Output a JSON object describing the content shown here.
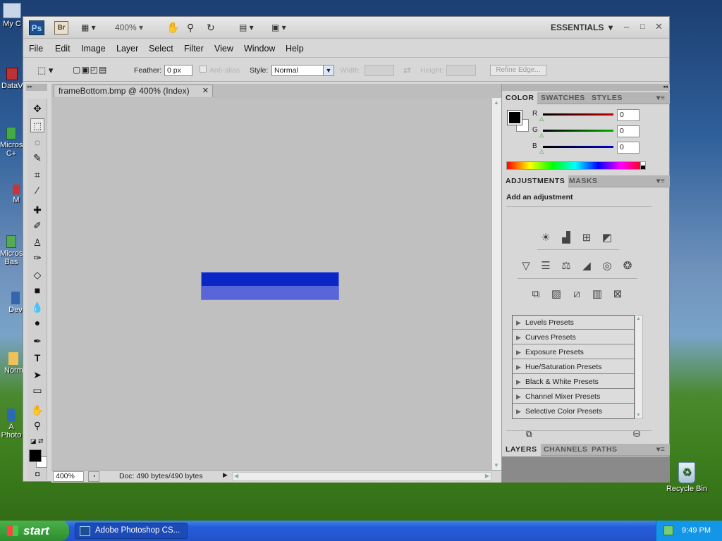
{
  "desktop": {
    "left_icons": [
      "My C",
      "DataV",
      "Micros C+",
      "M",
      "Micros Bas",
      "Dev",
      "Norm",
      "A Photo"
    ],
    "recycle_bin": "Recycle Bin"
  },
  "appbar": {
    "ps_logo": "Ps",
    "br_logo": "Br",
    "zoom": "400%",
    "workspace": "ESSENTIALS"
  },
  "menu": [
    "File",
    "Edit",
    "Image",
    "Layer",
    "Select",
    "Filter",
    "View",
    "Window",
    "Help"
  ],
  "options": {
    "feather_label": "Feather:",
    "feather_value": "0 px",
    "antialias_label": "Anti-alias",
    "style_label": "Style:",
    "style_value": "Normal",
    "width_label": "Width:",
    "height_label": "Height:",
    "refine_edge": "Refine Edge..."
  },
  "document": {
    "tab_title": "frameBottom.bmp @ 400% (Index)",
    "status_zoom": "400%",
    "status_doc": "Doc: 490 bytes/490 bytes",
    "frame_colors": {
      "top": "#0a26c4",
      "bottom": "#5a66d8"
    }
  },
  "color_panel": {
    "tabs": [
      "COLOR",
      "SWATCHES",
      "STYLES"
    ],
    "channels": [
      {
        "label": "R",
        "value": "0",
        "color": "#c80000"
      },
      {
        "label": "G",
        "value": "0",
        "color": "#00b000"
      },
      {
        "label": "B",
        "value": "0",
        "color": "#0000c8"
      }
    ]
  },
  "adjustments_panel": {
    "tabs": [
      "ADJUSTMENTS",
      "MASKS"
    ],
    "heading": "Add an adjustment",
    "presets": [
      "Levels Presets",
      "Curves Presets",
      "Exposure Presets",
      "Hue/Saturation Presets",
      "Black & White Presets",
      "Channel Mixer Presets",
      "Selective Color Presets"
    ]
  },
  "layers_panel": {
    "tabs": [
      "LAYERS",
      "CHANNELS",
      "PATHS"
    ]
  },
  "taskbar": {
    "start": "start",
    "window_button": "Adobe Photoshop CS...",
    "clock": "9:49 PM"
  }
}
